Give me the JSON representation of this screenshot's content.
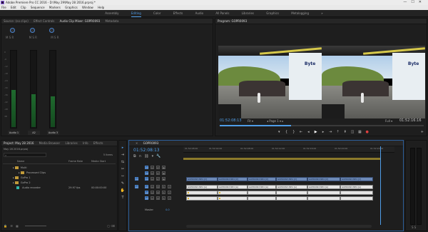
{
  "window": {
    "title": "Adobe Premiere Pro CC 2016 - D:\\May 29\\May 28 2016.prproj *",
    "min": "—",
    "max": "☐",
    "close": "✕"
  },
  "menu": [
    "File",
    "Edit",
    "Clip",
    "Sequence",
    "Markers",
    "Graphics",
    "Window",
    "Help"
  ],
  "workspaces": [
    {
      "label": "Assembly",
      "active": false
    },
    {
      "label": "Editing",
      "active": true
    },
    {
      "label": "Color",
      "active": false
    },
    {
      "label": "Effects",
      "active": false
    },
    {
      "label": "Audio",
      "active": false
    },
    {
      "label": "All Panels",
      "active": false
    },
    {
      "label": "Libraries",
      "active": false
    },
    {
      "label": "Graphics",
      "active": false
    },
    {
      "label": "Metalogging",
      "active": false
    }
  ],
  "workspace_more": "»",
  "source_panel": {
    "tabs": [
      "Source: (no clips)",
      "Effect Controls",
      "Audio Clip Mixer: GOPR0093",
      "Metadata"
    ],
    "active_tab": 2,
    "channels": [
      "Audio 1",
      "A2",
      "Audio 3"
    ],
    "scale": [
      "0",
      "-6",
      "-12",
      "-18",
      "-24",
      "-30",
      "-36",
      "-42",
      "-48",
      "dB"
    ],
    "meter_levels": [
      0.48,
      0.43,
      0.4
    ]
  },
  "program_panel": {
    "tab": "Program: GOPR0093",
    "banner": "Byte",
    "timecode_left": "01:52:08:13",
    "fit": "Fit",
    "page_label": "Page 1",
    "quality": "Full",
    "timecode_right": "01:52:16:16"
  },
  "project_panel": {
    "tabs": [
      "Project: May 28 2016",
      "Media Browser",
      "Libraries",
      "Info",
      "Effects"
    ],
    "active_tab": 0,
    "file": "May 28 2016.prproj",
    "items_count": "5 Items",
    "columns": [
      "Name",
      "Frame Rate",
      "Media Start"
    ],
    "rows": [
      {
        "name": "Multi",
        "fps": "",
        "start": "",
        "type": "bin"
      },
      {
        "name": "Processed Clips",
        "fps": "",
        "start": "",
        "type": "bin"
      },
      {
        "name": "GoPro 1",
        "fps": "",
        "start": "",
        "type": "bin"
      },
      {
        "name": "GoPro 2",
        "fps": "",
        "start": "",
        "type": "bin"
      },
      {
        "name": "Audio recorder",
        "fps": "29.97 fps",
        "start": "00:00:00:00",
        "type": "audio"
      }
    ]
  },
  "tools": [
    "▸",
    "⇥",
    "⇆",
    "✂",
    "⇿",
    "✎",
    "✋",
    "T"
  ],
  "timeline": {
    "tab": "GOPR0093",
    "timecode": "01:52:08:13",
    "ruler_ticks": [
      "01:52:08:00",
      "01:52:02:00",
      "01:52:08:00",
      "01:52:12:00",
      "01:52:16:00",
      "01:52:20:00",
      "01:52:24:00"
    ],
    "video_tracks": [
      "V3",
      "V2",
      "V1"
    ],
    "audio_tracks": [
      "A1",
      "A2",
      "A3"
    ],
    "master": "Master",
    "master_value": "0.0",
    "clip_label": "GOPR0093.MP4 [V]",
    "audio_clip_label": "GOPR0093.MP4 [A]"
  },
  "colors": {
    "accent": "#4f9de8",
    "video_clip": "#6d8ab7",
    "audio_clip": "#e6e6e6",
    "meter": "#1f6a2e"
  }
}
